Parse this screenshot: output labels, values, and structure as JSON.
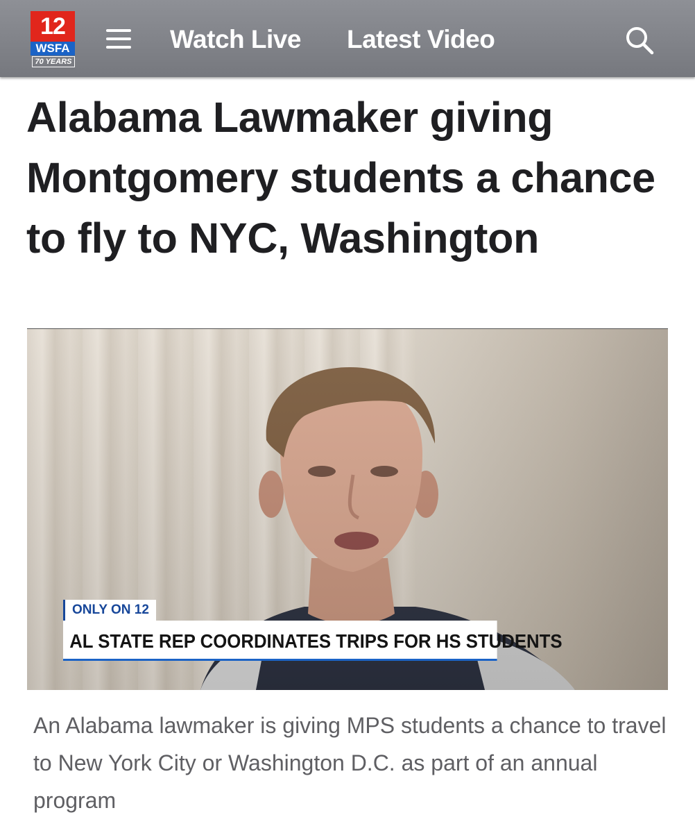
{
  "header": {
    "logo": {
      "number": "12",
      "call_letters": "WSFA",
      "anniversary": "70 YEARS"
    },
    "menu_icon": "hamburger-menu-icon",
    "nav": [
      {
        "label": "Watch Live"
      },
      {
        "label": "Latest Video"
      }
    ],
    "search_icon": "search-icon",
    "bar_color": "#7f8187"
  },
  "article": {
    "headline": "Alabama Lawmaker giving Montgomery students a chance to fly to NYC, Washington",
    "video": {
      "tag": "ONLY ON 12",
      "lower_third": "AL STATE REP COORDINATES TRIPS FOR HS STUDENTS",
      "tag_color": "#17479a"
    },
    "caption": "An Alabama lawmaker is giving MPS students a chance to travel to New York City or Washington D.C. as part of an annual program"
  }
}
